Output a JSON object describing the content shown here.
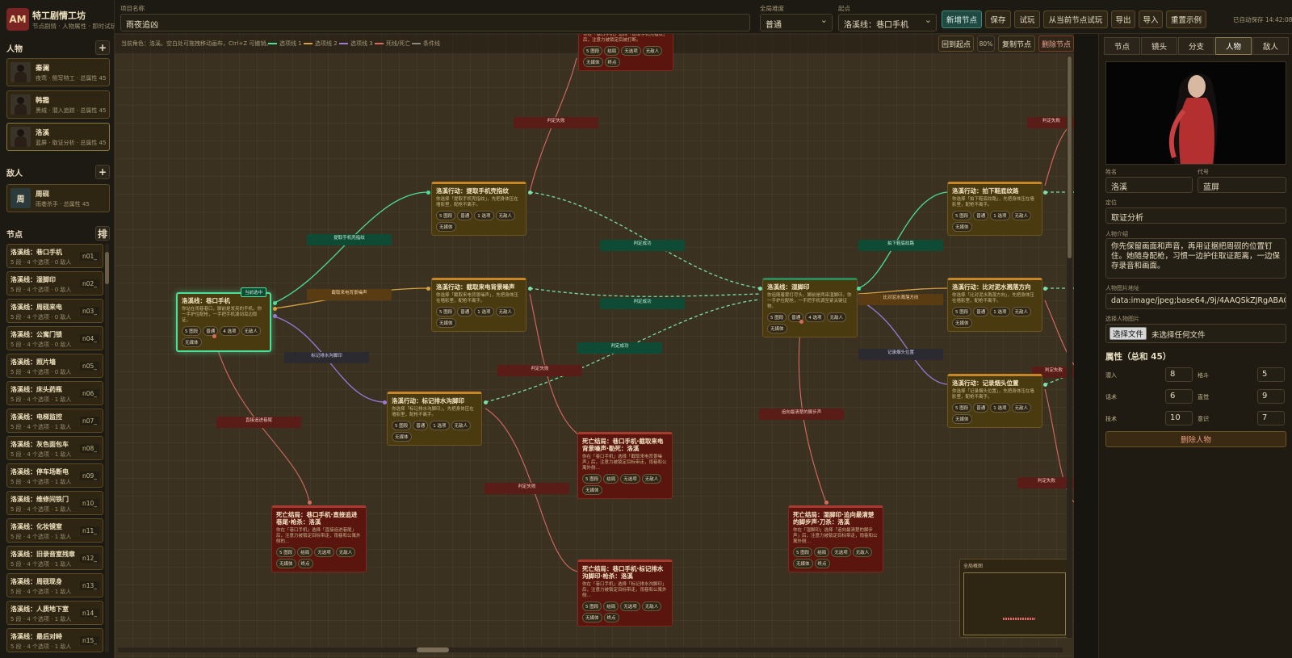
{
  "brand": {
    "logo": "AM",
    "title": "特工剧情工坊",
    "subtitle": "节点剧情 · 人物属性 · 即时试玩"
  },
  "sections": {
    "characters": "人物",
    "enemies": "敌人",
    "nodes": "节点",
    "sort": "排",
    "add": "+"
  },
  "characters": [
    {
      "name": "秦澜",
      "meta": "夜莺 · 侧写特工 · 总属性 45"
    },
    {
      "name": "韩霜",
      "meta": "黑绒 · 潜入追踪 · 总属性 45"
    },
    {
      "name": "洛溪",
      "meta": "蓝屏 · 取证分析 · 总属性 45"
    }
  ],
  "enemies": [
    {
      "avatar": "周",
      "name": "周砚",
      "meta": "雨巷杀手 · 总属性 45"
    }
  ],
  "node_list": [
    {
      "title": "洛溪线：巷口手机",
      "sub": "5 段 · 4 个选项 · 0 敌人",
      "id": "n01_"
    },
    {
      "title": "洛溪线：湿脚印",
      "sub": "5 段 · 4 个选项 · 0 敌人",
      "id": "n02_"
    },
    {
      "title": "洛溪线：周砚来电",
      "sub": "5 段 · 4 个选项 · 0 敌人",
      "id": "n03_"
    },
    {
      "title": "洛溪线：公寓门锁",
      "sub": "5 段 · 4 个选项 · 0 敌人",
      "id": "n04_"
    },
    {
      "title": "洛溪线：照片墙",
      "sub": "5 段 · 4 个选项 · 0 敌人",
      "id": "n05_"
    },
    {
      "title": "洛溪线：床头药瓶",
      "sub": "5 段 · 4 个选项 · 1 敌人",
      "id": "n06_"
    },
    {
      "title": "洛溪线：电梯监控",
      "sub": "5 段 · 4 个选项 · 1 敌人",
      "id": "n07_"
    },
    {
      "title": "洛溪线：灰色面包车",
      "sub": "5 段 · 4 个选项 · 1 敌人",
      "id": "n08_"
    },
    {
      "title": "洛溪线：停车场断电",
      "sub": "5 段 · 4 个选项 · 1 敌人",
      "id": "n09_"
    },
    {
      "title": "洛溪线：维修间铁门",
      "sub": "5 段 · 4 个选项 · 1 敌人",
      "id": "n10_"
    },
    {
      "title": "洛溪线：化妆镜室",
      "sub": "5 段 · 4 个选项 · 1 敌人",
      "id": "n11_"
    },
    {
      "title": "洛溪线：旧录音室残章",
      "sub": "5 段 · 4 个选项 · 1 敌人",
      "id": "n12_"
    },
    {
      "title": "洛溪线：周砚现身",
      "sub": "5 段 · 4 个选项 · 1 敌人",
      "id": "n13_"
    },
    {
      "title": "洛溪线：人质地下室",
      "sub": "5 段 · 4 个选项 · 1 敌人",
      "id": "n14_"
    },
    {
      "title": "洛溪线：最后对峙",
      "sub": "5 段 · 4 个选项 · 1 敌人",
      "id": "n15_"
    }
  ],
  "topbar": {
    "project_label": "项目名称",
    "project_value": "雨夜追凶",
    "difficulty_label": "全局难度",
    "difficulty_value": "普通",
    "start_label": "起点",
    "start_value": "洛溪线：巷口手机",
    "buttons": [
      "新增节点",
      "保存",
      "试玩",
      "从当前节点试玩",
      "导出",
      "导入",
      "重置示例"
    ],
    "autosave": "已自动保存 14:42:08"
  },
  "canvas": {
    "hint": "当前角色：洛溪。空白处可拖拽移动画布，Ctrl+Z 可撤销。",
    "legend": [
      {
        "label": "选项线 1",
        "color": "#4adf9a"
      },
      {
        "label": "选项线 2",
        "color": "#d8a040"
      },
      {
        "label": "选项线 3",
        "color": "#9a7ad8"
      },
      {
        "label": "死线/死亡",
        "color": "#d86a60"
      },
      {
        "label": "条件线",
        "color": "#8a8a80"
      }
    ],
    "buttons": {
      "back": "回到起点",
      "zoom": "80%",
      "copy": "复制节点",
      "delete": "删除节点"
    },
    "minimap_title": "全局概图",
    "current_badge": "当前选中"
  },
  "edge_labels": {
    "e1": "提取手机壳指纹",
    "e2": "截取来电背景噪声",
    "e3": "标记排水沟脚印",
    "e4": "直接追进巷尾",
    "e5": "判定成功",
    "e6": "判定成功",
    "e7": "判定成功",
    "e8": "判定失败",
    "e9": "判定失败",
    "e10": "判定失败",
    "e11": "拍下鞋底纹路",
    "e12": "比对泥水溅落方向",
    "e13": "记录烟头位置",
    "e14": "追向最清楚的脚步声",
    "e15": "判定失败",
    "e16": "判定失败",
    "e17": "判定失败",
    "e18": "判定失败"
  },
  "nodes": {
    "start": {
      "title": "洛溪线：巷口手机",
      "desc": "你站在雨巷巷口，脚前是发亮的手机。你一手护住配枪，一手把手机凑到耳边取证。",
      "tags": [
        "5 图段",
        "普通",
        "4 选项",
        "无敌人",
        "无媒体"
      ]
    },
    "a1": {
      "title": "洛溪行动：提取手机壳指纹",
      "desc": "你选择「提取手机壳指纹」，先把身体压在墙影里，配枪不离手。",
      "tags": [
        "5 图段",
        "普通",
        "1 选项",
        "无敌人",
        "无媒体"
      ]
    },
    "a2": {
      "title": "洛溪行动：截取来电背景噪声",
      "desc": "你选择「截取来电背景噪声」，先把身体压在墙影里，配枪不离手。",
      "tags": [
        "5 图段",
        "普通",
        "1 选项",
        "无敌人",
        "无媒体"
      ]
    },
    "a3": {
      "title": "洛溪行动：标记排水沟脚印",
      "desc": "你选择「标记排水沟脚印」，先把身体压在墙影里，配枪不离手。",
      "tags": [
        "5 图段",
        "普通",
        "1 选项",
        "无敌人",
        "无媒体"
      ]
    },
    "top": {
      "title": "",
      "desc": "你在「巷口手机」选择「提取手机壳指纹」后，注意力被锁定后被打断。",
      "tags": [
        "5 图段",
        "结局",
        "无选项",
        "无敌人",
        "无媒体",
        "终点"
      ]
    },
    "d1": {
      "title": "死亡结局：巷口手机·直接追进巷尾·枪杀：洛溪",
      "desc": "你在「巷口手机」选择「直接追进巷尾」后，注意力被锁定目标带走，雨巷和公寓外侧的…",
      "tags": [
        "5 图段",
        "结局",
        "无选项",
        "无敌人",
        "无媒体",
        "终点"
      ]
    },
    "d2": {
      "title": "死亡结局：巷口手机·截取来电背景噪声·勒死：洛溪",
      "desc": "你在「巷口手机」选择「截取来电背景噪声」后，注意力被锁定目标带走，雨巷和公寓外侧…",
      "tags": [
        "5 图段",
        "结局",
        "无选项",
        "无敌人",
        "无媒体"
      ]
    },
    "d3": {
      "title": "死亡结局：巷口手机·标记排水沟脚印·枪杀：洛溪",
      "desc": "你在「巷口手机」选择「标记排水沟脚印」后，注意力被锁定目标带走，雨巷和公寓外侧…",
      "tags": [
        "5 图段",
        "结局",
        "无选项",
        "无敌人",
        "无媒体",
        "终点"
      ]
    },
    "mid": {
      "title": "洛溪线：湿脚印",
      "desc": "你追随着雾灯尽头，脚前是两串湿脚印。你一手护住配枪，一手把手机调至紧关键证物。",
      "tags": [
        "5 图段",
        "普通",
        "4 选项",
        "无敌人",
        "无媒体"
      ]
    },
    "d4": {
      "title": "死亡结局：湿脚印·追向最清楚的脚步声·刀杀：洛溪",
      "desc": "你在「湿脚印」选择「追向最清楚的脚步声」后，注意力被锁定目标带走，雨巷和公寓外侧…",
      "tags": [
        "5 图段",
        "结局",
        "无选项",
        "无敌人",
        "无媒体",
        "终点"
      ]
    },
    "r1": {
      "title": "洛溪行动：拍下鞋底纹路",
      "desc": "你选择「拍下鞋底纹路」，先把身体压在墙影里，配枪不离手。",
      "tags": [
        "5 图段",
        "普通",
        "1 选项",
        "无敌人",
        "无媒体"
      ]
    },
    "r2": {
      "title": "洛溪行动：比对泥水溅落方向",
      "desc": "你选择「比对泥水溅落方向」，先把身体压在墙影里，配枪不离手。",
      "tags": [
        "5 图段",
        "普通",
        "1 选项",
        "无敌人",
        "无媒体"
      ]
    },
    "r3": {
      "title": "洛溪行动：记录烟头位置",
      "desc": "你选择「记录烟头位置」，先把身体压在墙影里，配枪不离手。",
      "tags": [
        "5 图段",
        "普通",
        "1 选项",
        "无敌人",
        "无媒体"
      ]
    }
  },
  "rpanel": {
    "tabs": [
      "节点",
      "镜头",
      "分支",
      "人物",
      "敌人"
    ],
    "active_tab": "人物",
    "name_label": "姓名",
    "name_value": "洛溪",
    "code_label": "代号",
    "code_value": "蓝屏",
    "role_label": "定位",
    "role_value": "取证分析",
    "intro_label": "人物介绍",
    "intro_value": "你先保留画面和声音，再用证据把周砚的位置钉住。她随身配枪，习惯一边护住取证距离，一边保存录音和画面。",
    "image_url_label": "人物图片地址",
    "image_url_value": "data:image/jpeg;base64,/9j/4AAQSkZJRgABAQEA",
    "image_select_label": "选择人物图片",
    "file_button": "选择文件",
    "file_none": "未选择任何文件",
    "attr_title": "属性（总和 45）",
    "attrs": [
      {
        "label": "潜入",
        "value": "8"
      },
      {
        "label": "格斗",
        "value": "5"
      },
      {
        "label": "话术",
        "value": "6"
      },
      {
        "label": "直觉",
        "value": "9"
      },
      {
        "label": "技术",
        "value": "10"
      },
      {
        "label": "意识",
        "value": "7"
      }
    ],
    "delete_button": "删除人物"
  }
}
